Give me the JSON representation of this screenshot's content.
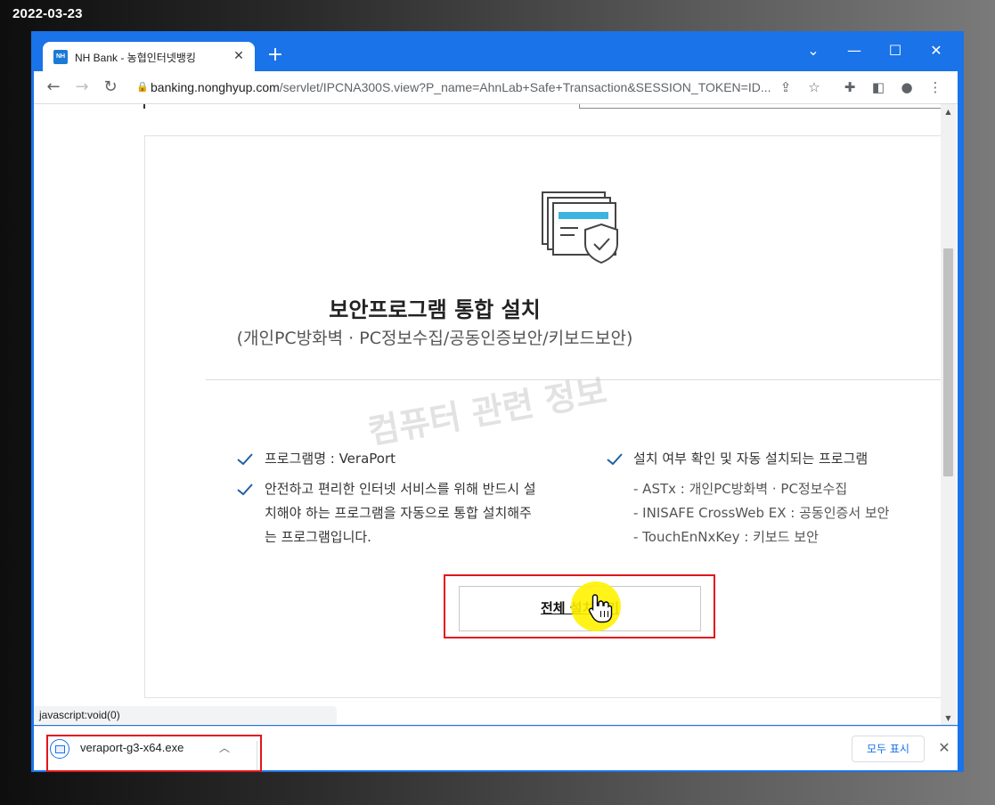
{
  "screenshot_date": "2022-03-23",
  "browser": {
    "tab": {
      "favicon_text": "NH",
      "title": "NH Bank - 농협인터넷뱅킹",
      "close": "✕"
    },
    "new_tab": "+",
    "window_controls": {
      "menu": "⌄",
      "minimize": "—",
      "maximize": "☐",
      "close": "✕"
    },
    "address": {
      "host": "banking.nonghyup.com",
      "path": "/servlet/IPCNA300S.view?P_name=AhnLab+Safe+Transaction&SESSION_TOKEN=ID..."
    },
    "status_text": "javascript:void(0)"
  },
  "page": {
    "title": "보안프로그램 통합 설치",
    "subtitle": "(개인PC방화벽 · PC정보수집/공동인증보안/키보드보안)",
    "watermark": "컴퓨터 관련 정보",
    "left_items": [
      {
        "text": "프로그램명 : VeraPort"
      },
      {
        "lines": [
          "안전하고 편리한 인터넷 서비스를 위해 반드시 설",
          "치해야 하는 프로그램을 자동으로 통합 설치해주",
          "는 프로그램입니다."
        ]
      }
    ],
    "right_heading": "설치 여부 확인 및 자동 설치되는 프로그램",
    "right_items": [
      "- ASTx : 개인PC방화벽 · PC정보수집",
      "- INISAFE CrossWeb EX : 공동인증서 보안",
      "- TouchEnNxKey : 키보드 보안"
    ],
    "install_button": "전체 설치하기"
  },
  "download_bar": {
    "file_name": "veraport-g3-x64.exe",
    "show_all": "모두 표시"
  },
  "colors": {
    "chrome_blue": "#1a73e8",
    "highlight_red": "#e0151b",
    "check_blue": "#1e5fa8",
    "hero_accent": "#3db4e0"
  }
}
